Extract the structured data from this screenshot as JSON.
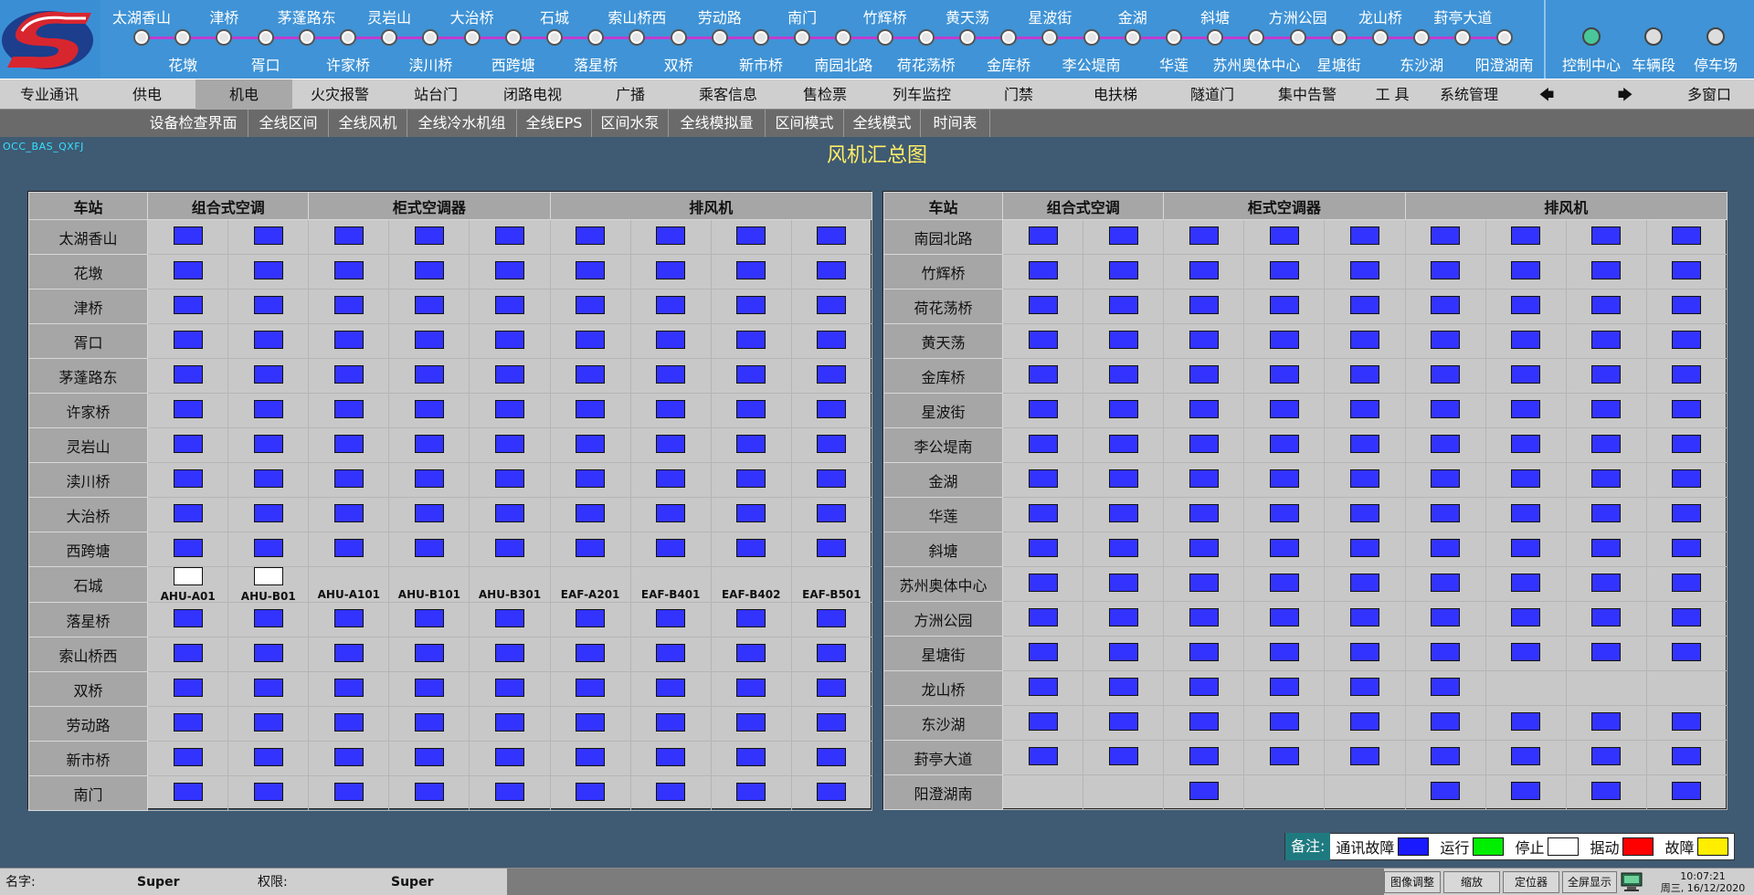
{
  "top_bar": {
    "stations_top": [
      "太湖香山",
      "津桥",
      "茅蓬路东",
      "灵岩山",
      "大治桥",
      "石城",
      "索山桥西",
      "劳动路",
      "南门",
      "竹辉桥",
      "黄天荡",
      "星波街",
      "金湖",
      "斜塘",
      "方洲公园",
      "龙山桥",
      "葑亭大道"
    ],
    "stations_bottom": [
      "花墩",
      "胥口",
      "许家桥",
      "渎川桥",
      "西跨塘",
      "落星桥",
      "双桥",
      "新市桥",
      "南园北路",
      "荷花荡桥",
      "金库桥",
      "李公堤南",
      "华莲",
      "苏州奥体中心",
      "星塘街",
      "东沙湖",
      "阳澄湖南"
    ],
    "right_items": [
      {
        "label": "控制中心",
        "color": "#49c79a"
      },
      {
        "label": "车辆段",
        "color": "#dddddd"
      },
      {
        "label": "停车场",
        "color": "#dddddd"
      }
    ],
    "line_color": "#c23bd0"
  },
  "menu1": [
    {
      "label": "专业通讯",
      "active": false
    },
    {
      "label": "供电",
      "active": false
    },
    {
      "label": "机电",
      "active": true
    },
    {
      "label": "火灾报警",
      "active": false
    },
    {
      "label": "站台门",
      "active": false
    },
    {
      "label": "闭路电视",
      "active": false
    },
    {
      "label": "广播",
      "active": false
    },
    {
      "label": "乘客信息",
      "active": false
    },
    {
      "label": "售检票",
      "active": false
    },
    {
      "label": "列车监控",
      "active": false
    },
    {
      "label": "门禁",
      "active": false
    },
    {
      "label": "电扶梯",
      "active": false
    },
    {
      "label": "隧道门",
      "active": false
    },
    {
      "label": "集中告警",
      "active": false
    },
    {
      "label": "工 具",
      "active": false
    },
    {
      "label": "系统管理",
      "active": false
    },
    {
      "label": "🡄",
      "active": false
    },
    {
      "label": "🡆",
      "active": false
    },
    {
      "label": "多窗口",
      "active": false
    }
  ],
  "menu2": [
    "设备检查界面",
    "全线区间",
    "全线风机",
    "全线冷水机组",
    "全线EPS",
    "区间水泵",
    "全线模拟量",
    "区间模式",
    "全线模式",
    "时间表"
  ],
  "page": {
    "ident": "OCC_BAS_QXFJ",
    "title": "风机汇总图"
  },
  "table_headers": {
    "station": "车站",
    "groups": [
      "组合式空调",
      "柜式空调器",
      "排风机"
    ]
  },
  "left_panel": {
    "rows": [
      {
        "name": "太湖香山",
        "fans": [
          1,
          1,
          1,
          1,
          1,
          1,
          1,
          1,
          1
        ]
      },
      {
        "name": "花墩",
        "fans": [
          1,
          1,
          1,
          1,
          1,
          1,
          1,
          1,
          1
        ]
      },
      {
        "name": "津桥",
        "fans": [
          1,
          1,
          1,
          1,
          1,
          1,
          1,
          1,
          1
        ]
      },
      {
        "name": "胥口",
        "fans": [
          1,
          1,
          1,
          1,
          1,
          1,
          1,
          1,
          1
        ]
      },
      {
        "name": "茅蓬路东",
        "fans": [
          1,
          1,
          1,
          1,
          1,
          1,
          1,
          1,
          1
        ]
      },
      {
        "name": "许家桥",
        "fans": [
          1,
          1,
          1,
          1,
          1,
          1,
          1,
          1,
          1
        ]
      },
      {
        "name": "灵岩山",
        "fans": [
          1,
          1,
          1,
          1,
          1,
          1,
          1,
          1,
          1
        ]
      },
      {
        "name": "渎川桥",
        "fans": [
          1,
          1,
          1,
          1,
          1,
          1,
          1,
          1,
          1
        ]
      },
      {
        "name": "大治桥",
        "fans": [
          1,
          1,
          1,
          1,
          1,
          1,
          1,
          1,
          1
        ]
      },
      {
        "name": "西跨塘",
        "fans": [
          1,
          1,
          1,
          1,
          1,
          1,
          1,
          1,
          1
        ]
      },
      {
        "name": "石城",
        "fans": [
          2,
          2,
          0,
          0,
          0,
          0,
          0,
          0,
          0
        ],
        "labels": [
          "AHU-A01",
          "AHU-B01",
          "AHU-A101",
          "AHU-B101",
          "AHU-B301",
          "EAF-A201",
          "EAF-B401",
          "EAF-B402",
          "EAF-B501"
        ]
      },
      {
        "name": "落星桥",
        "fans": [
          1,
          1,
          1,
          1,
          1,
          1,
          1,
          1,
          1
        ]
      },
      {
        "name": "索山桥西",
        "fans": [
          1,
          1,
          1,
          1,
          1,
          1,
          1,
          1,
          1
        ]
      },
      {
        "name": "双桥",
        "fans": [
          1,
          1,
          1,
          1,
          1,
          1,
          1,
          1,
          1
        ]
      },
      {
        "name": "劳动路",
        "fans": [
          1,
          1,
          1,
          1,
          1,
          1,
          1,
          1,
          1
        ]
      },
      {
        "name": "新市桥",
        "fans": [
          1,
          1,
          1,
          1,
          1,
          1,
          1,
          1,
          1
        ]
      },
      {
        "name": "南门",
        "fans": [
          1,
          1,
          1,
          1,
          1,
          1,
          1,
          1,
          1
        ]
      }
    ]
  },
  "right_panel": {
    "rows": [
      {
        "name": "南园北路",
        "fans": [
          1,
          1,
          1,
          1,
          1,
          1,
          1,
          1,
          1
        ]
      },
      {
        "name": "竹辉桥",
        "fans": [
          1,
          1,
          1,
          1,
          1,
          1,
          1,
          1,
          1
        ]
      },
      {
        "name": "荷花荡桥",
        "fans": [
          1,
          1,
          1,
          1,
          1,
          1,
          1,
          1,
          1
        ]
      },
      {
        "name": "黄天荡",
        "fans": [
          1,
          1,
          1,
          1,
          1,
          1,
          1,
          1,
          1
        ]
      },
      {
        "name": "金库桥",
        "fans": [
          1,
          1,
          1,
          1,
          1,
          1,
          1,
          1,
          1
        ]
      },
      {
        "name": "星波街",
        "fans": [
          1,
          1,
          1,
          1,
          1,
          1,
          1,
          1,
          1
        ]
      },
      {
        "name": "李公堤南",
        "fans": [
          1,
          1,
          1,
          1,
          1,
          1,
          1,
          1,
          1
        ]
      },
      {
        "name": "金湖",
        "fans": [
          1,
          1,
          1,
          1,
          1,
          1,
          1,
          1,
          1
        ]
      },
      {
        "name": "华莲",
        "fans": [
          1,
          1,
          1,
          1,
          1,
          1,
          1,
          1,
          1
        ]
      },
      {
        "name": "斜塘",
        "fans": [
          1,
          1,
          1,
          1,
          1,
          1,
          1,
          1,
          1
        ]
      },
      {
        "name": "苏州奥体中心",
        "fans": [
          1,
          1,
          1,
          1,
          1,
          1,
          1,
          1,
          1
        ]
      },
      {
        "name": "方洲公园",
        "fans": [
          1,
          1,
          1,
          1,
          1,
          1,
          1,
          1,
          1
        ]
      },
      {
        "name": "星塘街",
        "fans": [
          1,
          1,
          1,
          1,
          1,
          1,
          1,
          1,
          1
        ]
      },
      {
        "name": "龙山桥",
        "fans": [
          1,
          1,
          1,
          1,
          1,
          1,
          0,
          0,
          0
        ]
      },
      {
        "name": "东沙湖",
        "fans": [
          1,
          1,
          1,
          1,
          1,
          1,
          1,
          1,
          1
        ]
      },
      {
        "name": "葑亭大道",
        "fans": [
          1,
          1,
          1,
          1,
          1,
          1,
          1,
          1,
          1
        ]
      },
      {
        "name": "阳澄湖南",
        "fans": [
          0,
          0,
          1,
          0,
          0,
          1,
          1,
          1,
          1
        ]
      }
    ]
  },
  "legend": {
    "title": "备注:",
    "items": [
      {
        "label": "通讯故障",
        "color": "#1a1aff"
      },
      {
        "label": "运行",
        "color": "#00ee00"
      },
      {
        "label": "停止",
        "color": "#ffffff"
      },
      {
        "label": "据动",
        "color": "#ff0000"
      },
      {
        "label": "故障",
        "color": "#ffee00"
      }
    ]
  },
  "status_bar": {
    "name_label": "名字:",
    "name_value": "Super",
    "perm_label": "权限:",
    "perm_value": "Super",
    "buttons": [
      "图像调整",
      "缩放",
      "定位器",
      "全屏显示"
    ],
    "time": "10:07:21",
    "date": "周三, 16/12/2020"
  }
}
